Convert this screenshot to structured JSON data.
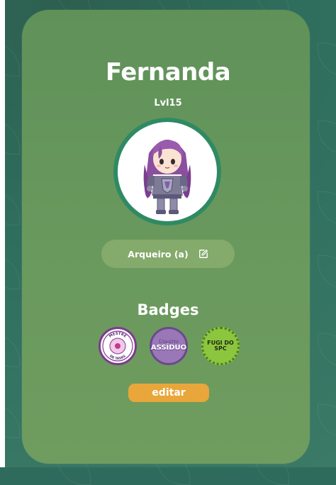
{
  "profile": {
    "name": "Fernanda",
    "level": "Lvl15",
    "class_label": "Arqueiro (a)"
  },
  "badges": {
    "title": "Badges",
    "items": [
      {
        "top_text": "MESTRE",
        "bottom_text": "DE TASKS"
      },
      {
        "script_text": "Usuário",
        "main_text": "ASSÍDUO"
      },
      {
        "line1": "FUGI DO",
        "line2": "SPC"
      }
    ]
  },
  "actions": {
    "edit_label": "editar"
  },
  "colors": {
    "card": "#6b9a5e",
    "pill": "#84aa6c",
    "avatar_ring": "#2f8a64",
    "edit_button": "#e9a63a"
  },
  "icons": {
    "class_edit": "edit-square-pen-icon"
  }
}
